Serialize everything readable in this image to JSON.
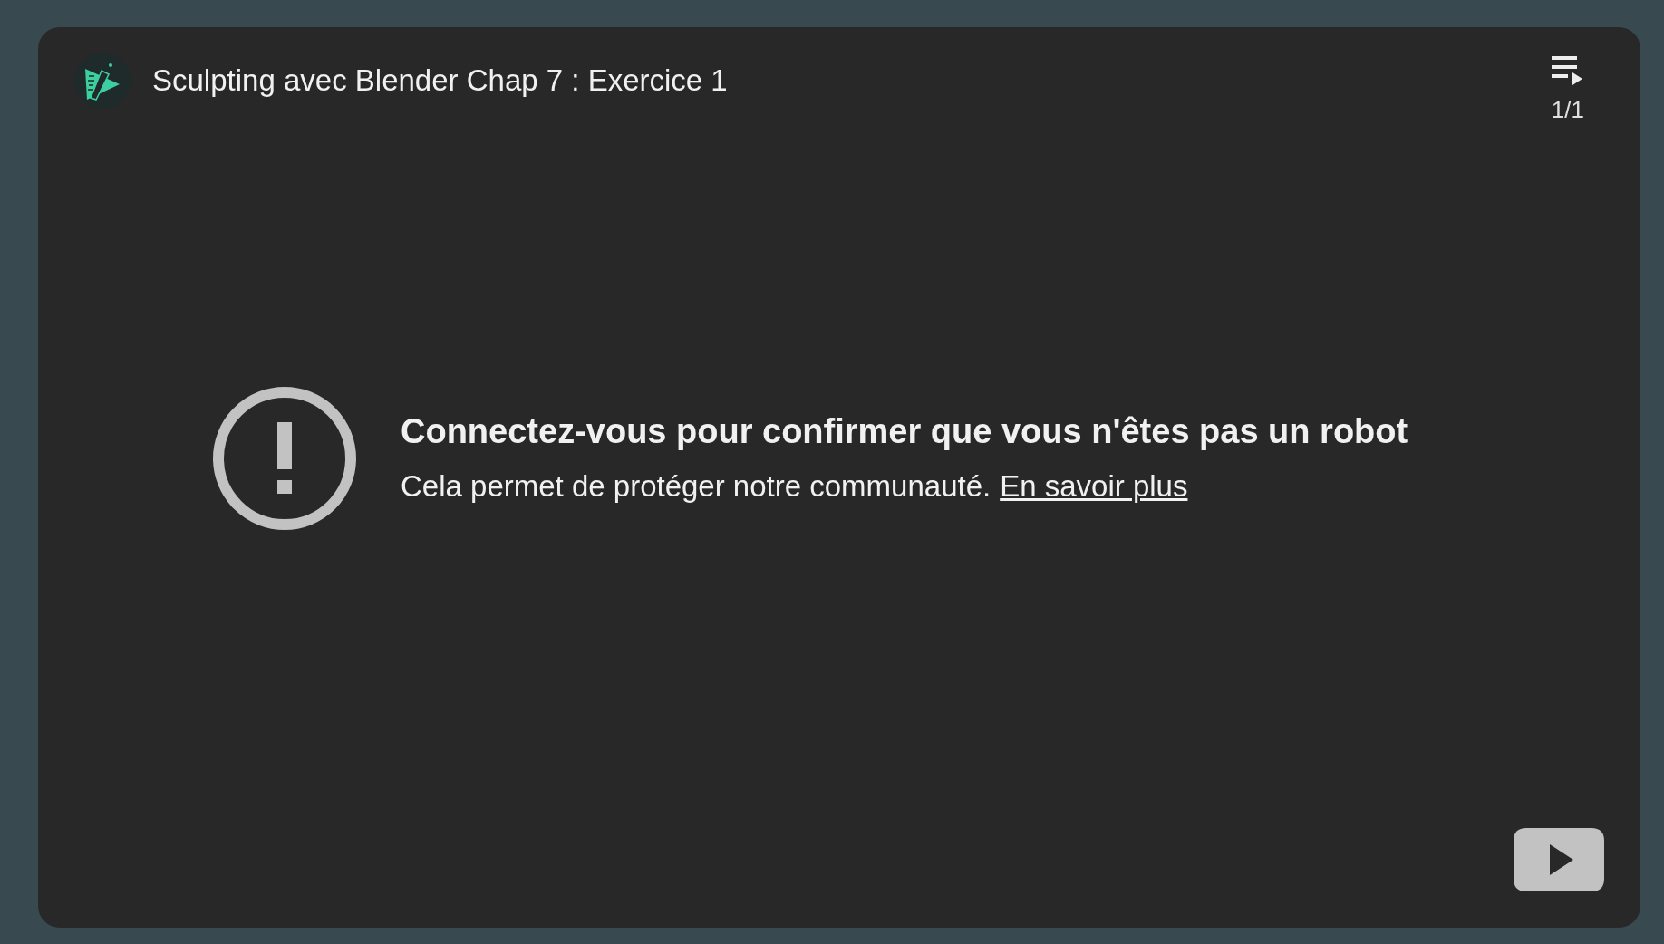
{
  "header": {
    "title": "Sculpting avec Blender Chap 7 : Exercice 1",
    "playlist_count": "1/1"
  },
  "message": {
    "heading": "Connectez-vous pour confirmer que vous n'êtes pas un robot",
    "body": "Cela permet de protéger notre communauté.",
    "link": "En savoir plus"
  }
}
